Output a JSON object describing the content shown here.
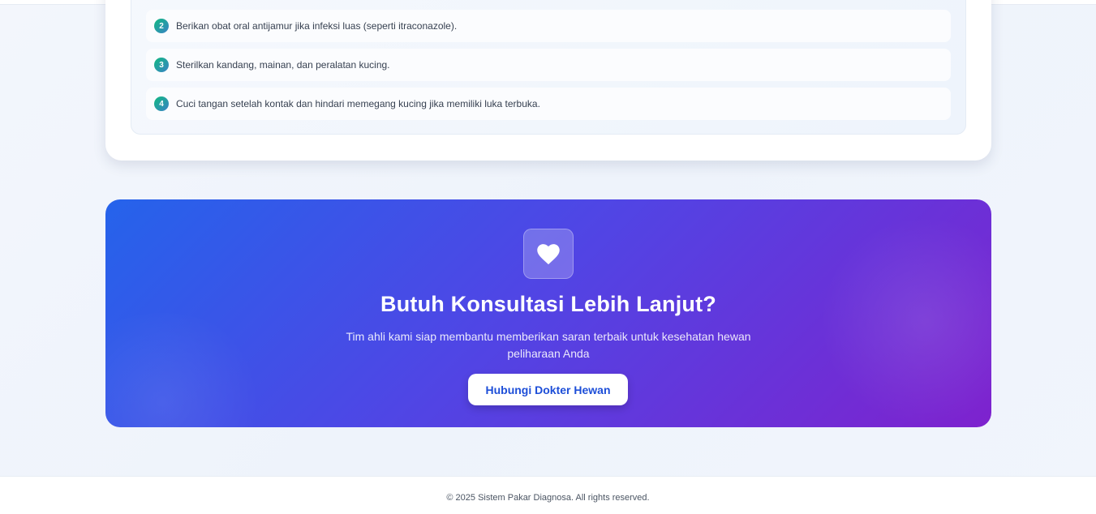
{
  "treatment_steps": [
    {
      "number": "2",
      "text": "Berikan obat oral antijamur jika infeksi luas (seperti itraconazole)."
    },
    {
      "number": "3",
      "text": "Sterilkan kandang, mainan, dan peralatan kucing."
    },
    {
      "number": "4",
      "text": "Cuci tangan setelah kontak dan hindari memegang kucing jika memiliki luka terbuka."
    }
  ],
  "cta": {
    "icon": "heart-icon",
    "title": "Butuh Konsultasi Lebih Lanjut?",
    "subtitle": "Tim ahli kami siap membantu memberikan saran terbaik untuk kesehatan hewan peliharaan Anda",
    "button_label": "Hubungi Dokter Hewan"
  },
  "footer": {
    "text": "© 2025 Sistem Pakar Diagnosa. All rights reserved."
  },
  "colors": {
    "cta_gradient_start": "#2563eb",
    "cta_gradient_end": "#7e22ce",
    "step_badge": "#10b981",
    "button_text": "#1d4ed8"
  }
}
